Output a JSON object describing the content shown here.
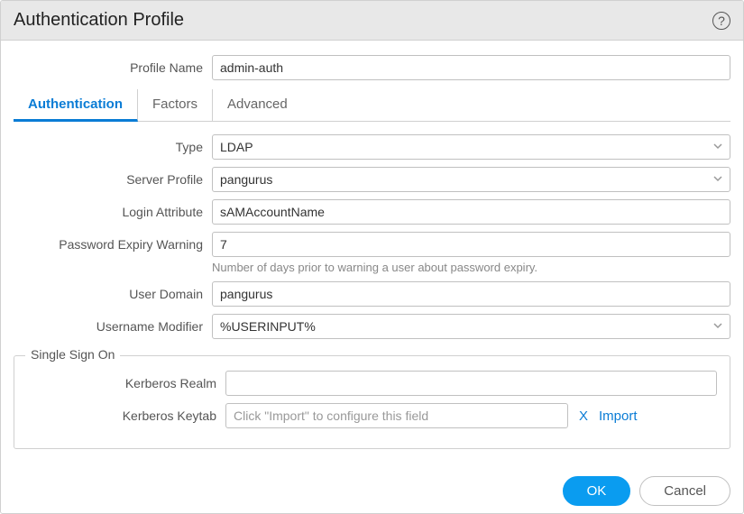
{
  "dialog": {
    "title": "Authentication Profile"
  },
  "profileName": {
    "label": "Profile Name",
    "value": "admin-auth"
  },
  "tabs": [
    {
      "label": "Authentication",
      "active": true
    },
    {
      "label": "Factors",
      "active": false
    },
    {
      "label": "Advanced",
      "active": false
    }
  ],
  "fields": {
    "type": {
      "label": "Type",
      "value": "LDAP"
    },
    "serverProfile": {
      "label": "Server Profile",
      "value": "pangurus"
    },
    "loginAttribute": {
      "label": "Login Attribute",
      "value": "sAMAccountName"
    },
    "passwordExpiry": {
      "label": "Password Expiry Warning",
      "value": "7",
      "help": "Number of days prior to warning a user about password expiry."
    },
    "userDomain": {
      "label": "User Domain",
      "value": "pangurus"
    },
    "usernameModifier": {
      "label": "Username Modifier",
      "value": "%USERINPUT%"
    }
  },
  "sso": {
    "legend": "Single Sign On",
    "kerberosRealm": {
      "label": "Kerberos Realm",
      "value": ""
    },
    "kerberosKeytab": {
      "label": "Kerberos Keytab",
      "placeholder": "Click \"Import\" to configure this field",
      "clear": "X",
      "import": "Import"
    }
  },
  "buttons": {
    "ok": "OK",
    "cancel": "Cancel"
  }
}
